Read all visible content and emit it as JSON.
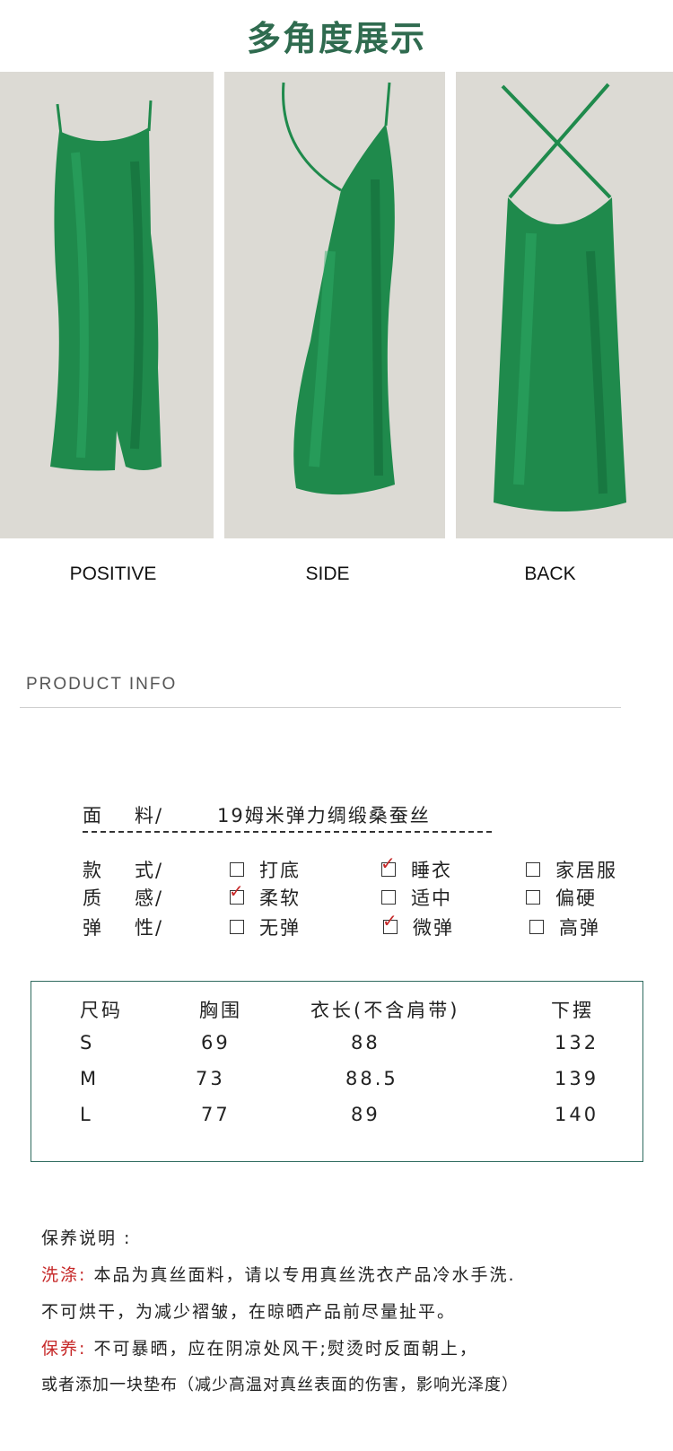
{
  "header": {
    "title": "多角度展示"
  },
  "views": [
    {
      "caption": "POSITIVE"
    },
    {
      "caption": "SIDE"
    },
    {
      "caption": "BACK"
    }
  ],
  "colors": {
    "dress": "#1f8a4c",
    "title": "#2f6b4f",
    "accent": "#c62828",
    "frame": "#2f6b5f"
  },
  "product_info": {
    "title": "PRODUCT INFO",
    "fabric": {
      "label_a": "面",
      "label_b": "料/",
      "value": "19姆米弹力绸缎桑蚕丝"
    },
    "style": {
      "label_a": "款",
      "label_b": "式/",
      "options": [
        {
          "label": "打底",
          "checked": false
        },
        {
          "label": "睡衣",
          "checked": true
        },
        {
          "label": "家居服",
          "checked": false
        }
      ]
    },
    "feel": {
      "label_a": "质",
      "label_b": "感/",
      "options": [
        {
          "label": "柔软",
          "checked": true
        },
        {
          "label": "适中",
          "checked": false
        },
        {
          "label": "偏硬",
          "checked": false
        }
      ]
    },
    "elasticity": {
      "label_a": "弹",
      "label_b": "性/",
      "options": [
        {
          "label": "无弹",
          "checked": false
        },
        {
          "label": "微弹",
          "checked": true
        },
        {
          "label": "高弹",
          "checked": false
        }
      ]
    }
  },
  "size_table": {
    "headers": [
      "尺码",
      "胸围",
      "衣长(不含肩带)",
      "下摆"
    ],
    "rows": [
      [
        "S",
        "69",
        "88",
        "132"
      ],
      [
        "M",
        "73",
        "88.5",
        "139"
      ],
      [
        "L",
        "77",
        "89",
        "140"
      ]
    ]
  },
  "care": {
    "heading": "保养说明 :",
    "wash_label": "洗涤:",
    "wash_text": "本品为真丝面料，请以专用真丝洗衣产品冷水手洗.",
    "wash_text2": "不可烘干，为减少褶皱，在晾晒产品前尽量扯平。",
    "keep_label": "保养:",
    "keep_text": "不可暴晒，应在阴凉处风干;熨烫时反面朝上，",
    "keep_text2": "或者添加一块垫布（减少高温对真丝表面的伤害，影响光泽度）"
  }
}
